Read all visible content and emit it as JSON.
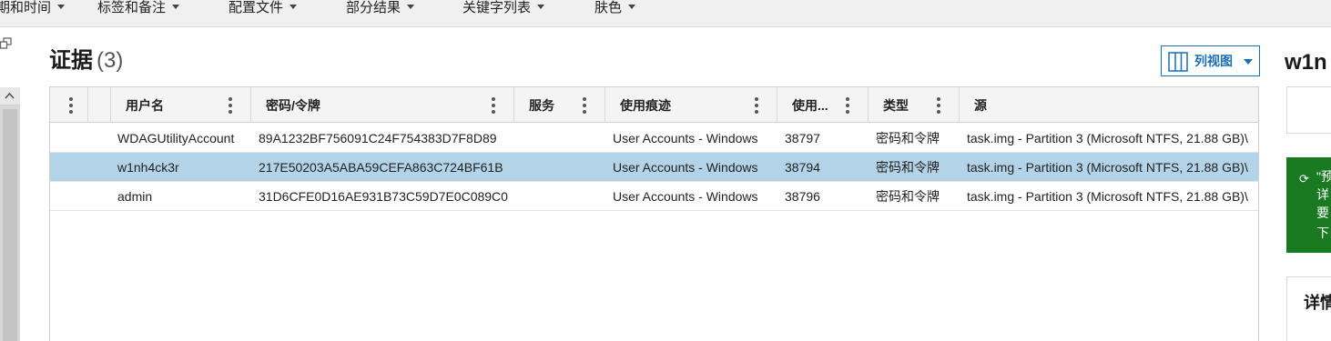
{
  "topbar": {
    "items": [
      {
        "label": "期和时间"
      },
      {
        "label": "标签和备注"
      },
      {
        "label": "配置文件"
      },
      {
        "label": "部分结果"
      },
      {
        "label": "关键字列表"
      },
      {
        "label": "肤色"
      }
    ]
  },
  "section": {
    "title": "证据",
    "count": "(3)"
  },
  "column_view_button": {
    "label": "列视图"
  },
  "table": {
    "columns": [
      {
        "label": ""
      },
      {
        "label": ""
      },
      {
        "label": "用户名"
      },
      {
        "label": "密码/令牌"
      },
      {
        "label": "服务"
      },
      {
        "label": "使用痕迹"
      },
      {
        "label": "使用..."
      },
      {
        "label": "类型"
      },
      {
        "label": "源"
      }
    ],
    "rows": [
      {
        "username": "WDAGUtilityAccount",
        "password": "89A1232BF756091C24F754383D7F8D89",
        "service": "",
        "usage": "User Accounts - Windows",
        "used": "38797",
        "type": "密码和令牌",
        "source": "task.img - Partition 3 (Microsoft NTFS, 21.88 GB)\\",
        "selected": false
      },
      {
        "username": "w1nh4ck3r",
        "password": "217E50203A5ABA59CEFA863C724BF61B",
        "service": "",
        "usage": "User Accounts - Windows",
        "used": "38794",
        "type": "密码和令牌",
        "source": "task.img - Partition 3 (Microsoft NTFS, 21.88 GB)\\",
        "selected": true
      },
      {
        "username": "admin",
        "password": "31D6CFE0D16AE931B73C59D7E0C089C0",
        "service": "",
        "usage": "User Accounts - Windows",
        "used": "38796",
        "type": "密码和令牌",
        "source": "task.img - Partition 3 (Microsoft NTFS, 21.88 GB)\\",
        "selected": false
      }
    ]
  },
  "right_panel": {
    "title": "w1n",
    "notice_lines": [
      "\"预",
      "详",
      "要",
      "下"
    ],
    "details_label": "详情"
  },
  "colors": {
    "selected_row": "#b3d4e8",
    "accent": "#1a6fb5",
    "notice_bg": "#1a7a22"
  }
}
